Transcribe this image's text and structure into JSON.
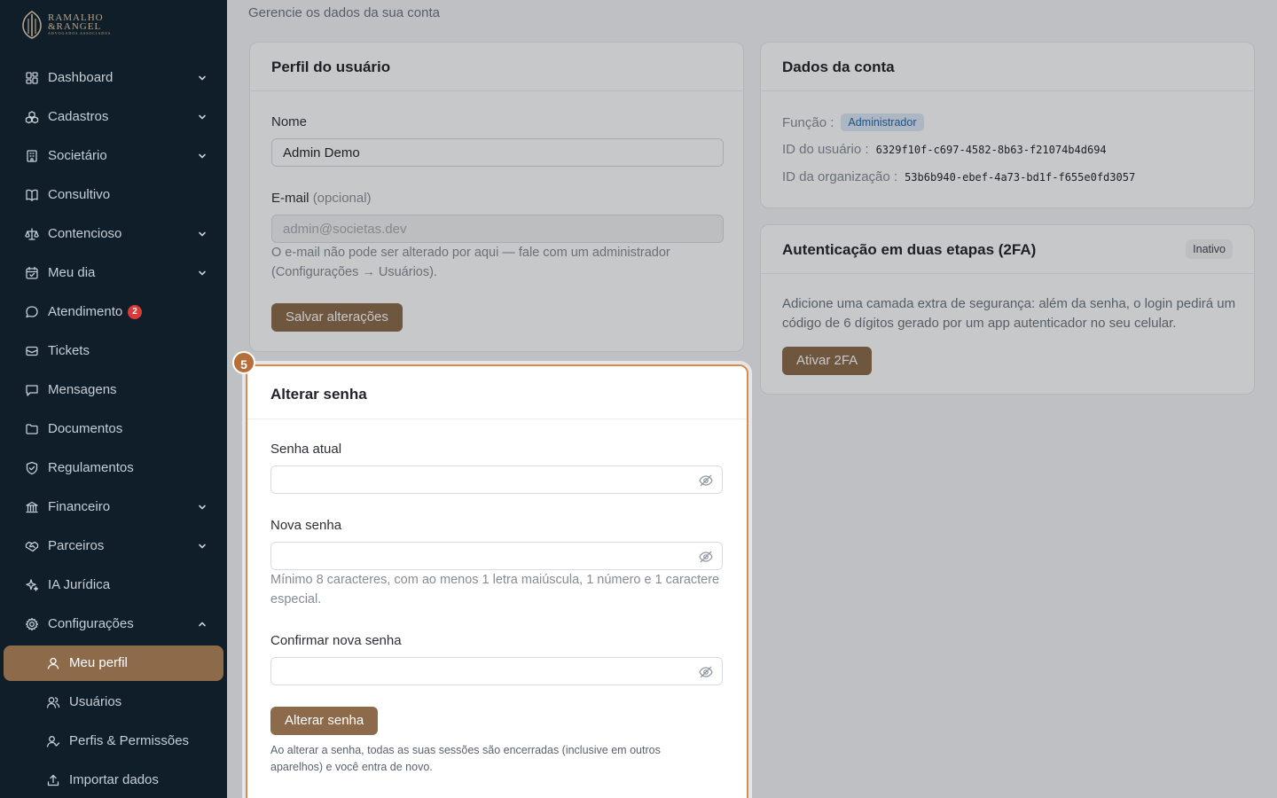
{
  "brand": {
    "line1": "RAMALHO",
    "line2": "&RANGEL",
    "line3": "ADVOGADOS ASSOCIADOS"
  },
  "sidebar": {
    "items": [
      {
        "label": "Dashboard",
        "icon": "dashboard-icon",
        "chevron": "down"
      },
      {
        "label": "Cadastros",
        "icon": "cubes-icon",
        "chevron": "down"
      },
      {
        "label": "Societário",
        "icon": "building-icon",
        "chevron": "down"
      },
      {
        "label": "Consultivo",
        "icon": "book-icon"
      },
      {
        "label": "Contencioso",
        "icon": "scale-icon",
        "chevron": "down"
      },
      {
        "label": "Meu dia",
        "icon": "calendar-icon",
        "chevron": "down"
      },
      {
        "label": "Atendimento",
        "icon": "chat-icon",
        "badge": "2"
      },
      {
        "label": "Tickets",
        "icon": "ticket-icon"
      },
      {
        "label": "Mensagens",
        "icon": "message-icon"
      },
      {
        "label": "Documentos",
        "icon": "folder-icon"
      },
      {
        "label": "Regulamentos",
        "icon": "shield-icon"
      },
      {
        "label": "Financeiro",
        "icon": "bank-icon",
        "chevron": "down"
      },
      {
        "label": "Parceiros",
        "icon": "handshake-icon",
        "chevron": "down"
      },
      {
        "label": "IA Jurídica",
        "icon": "sparkles-icon"
      },
      {
        "label": "Configurações",
        "icon": "gear-icon",
        "chevron": "up"
      }
    ],
    "subitems": [
      {
        "label": "Meu perfil",
        "icon": "user-icon",
        "active": true
      },
      {
        "label": "Usuários",
        "icon": "users-icon"
      },
      {
        "label": "Perfis & Permissões",
        "icon": "user-check-icon"
      },
      {
        "label": "Importar dados",
        "icon": "upload-icon"
      }
    ]
  },
  "page": {
    "subtitle": "Gerencie os dados da sua conta"
  },
  "profile": {
    "title": "Perfil do usuário",
    "name_label": "Nome",
    "name_value": "Admin Demo",
    "email_label": "E-mail",
    "email_optional": "(opcional)",
    "email_value": "admin@societas.dev",
    "email_help": "O e-mail não pode ser alterado por aqui — fale com um administrador (Configurações → Usuários).",
    "save_label": "Salvar alterações"
  },
  "account": {
    "title": "Dados da conta",
    "role_label": "Função :",
    "role_value": "Administrador",
    "user_id_label": "ID do usuário :",
    "user_id_value": "6329f10f-c697-4582-8b63-f21074b4d694",
    "org_id_label": "ID da organização :",
    "org_id_value": "53b6b940-ebef-4a73-bd1f-f655e0fd3057"
  },
  "twofa": {
    "title": "Autenticação em duas etapas (2FA)",
    "status": "Inativo",
    "description": "Adicione uma camada extra de segurança: além da senha, o login pedirá um código de 6 dígitos gerado por um app autenticador no seu celular.",
    "button_label": "Ativar 2FA"
  },
  "password": {
    "step": "5",
    "title": "Alterar senha",
    "current_label": "Senha atual",
    "new_label": "Nova senha",
    "new_help": "Mínimo 8 caracteres, com ao menos 1 letra maiúscula, 1 número e 1 caractere especial.",
    "confirm_label": "Confirmar nova senha",
    "button_label": "Alterar senha",
    "note": "Ao alterar a senha, todas as suas sessões são encerradas (inclusive em outros aparelhos) e você entra de novo."
  },
  "colors": {
    "sidebar_bg": "#0f1e29",
    "accent": "#8c6a4a",
    "highlight": "#d98a4c"
  }
}
